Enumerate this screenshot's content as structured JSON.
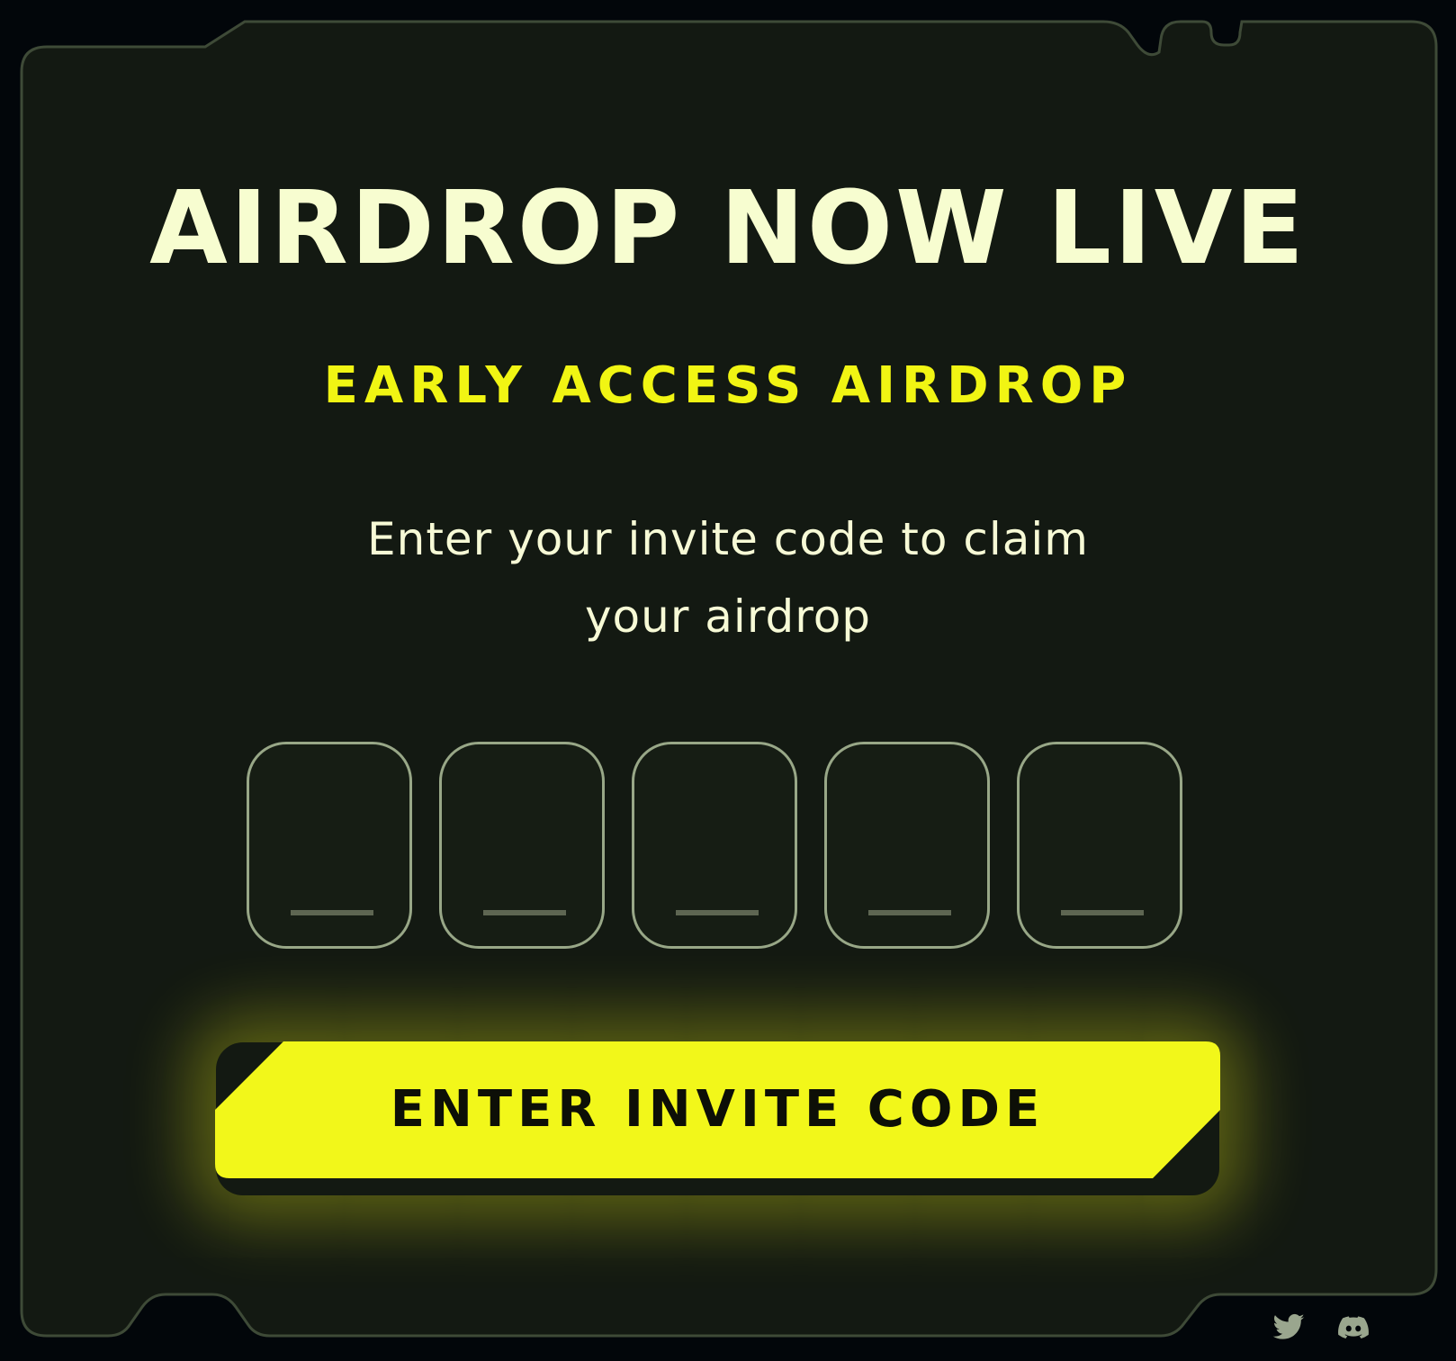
{
  "header": {
    "title": "AIRDROP NOW LIVE",
    "subtitle": "EARLY ACCESS AIRDROP"
  },
  "main": {
    "description_line1": "Enter your invite code to claim",
    "description_line2": "your airdrop",
    "code_inputs": [
      {
        "value": "",
        "placeholder": "_"
      },
      {
        "value": "",
        "placeholder": "_"
      },
      {
        "value": "",
        "placeholder": "_"
      },
      {
        "value": "",
        "placeholder": "_"
      },
      {
        "value": "",
        "placeholder": "_"
      }
    ],
    "cta_label": "ENTER INVITE CODE"
  },
  "footer": {
    "social_icons": [
      "twitter-icon",
      "discord-icon"
    ]
  },
  "colors": {
    "background": "#02060a",
    "panel": "#131912",
    "panel_border": "#3e4a37",
    "title": "#f7fdd0",
    "accent_yellow": "#f2f71a",
    "input_border": "#98a787",
    "cta_text": "#0d0f07",
    "icon": "#9aa68e"
  }
}
